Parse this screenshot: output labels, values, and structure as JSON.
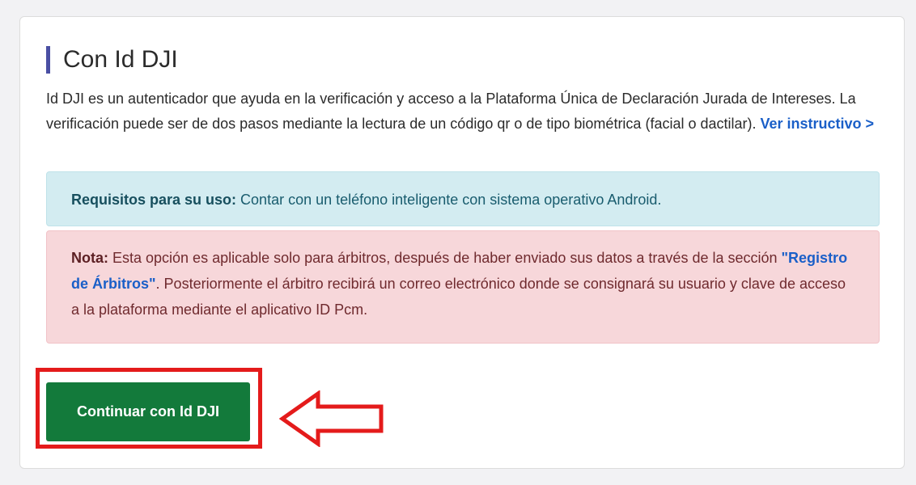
{
  "card": {
    "title": "Con Id DJI",
    "description": "Id DJI es un autenticador que ayuda en la verificación y acceso a la Plataforma Única de Declaración Jurada de Intereses. La verificación puede ser de dos pasos mediante la lectura de un código qr o de tipo biométrica (facial o dactilar).",
    "instructivo_link": "Ver instructivo >"
  },
  "requirements": {
    "label": "Requisitos para su uso:",
    "text": "Contar con un teléfono inteligente con sistema operativo Android."
  },
  "note": {
    "label": "Nota:",
    "text_before": "Esta opción es aplicable solo para árbitros, después de haber enviado sus datos a través de la sección",
    "link": "\"Registro de Árbitros\"",
    "text_after": ". Posteriormente el árbitro recibirá un correo electrónico donde se consignará su usuario y clave de acceso a la plataforma mediante el aplicativo ID Pcm."
  },
  "button": {
    "label": "Continuar con Id DJI"
  },
  "colors": {
    "title_accent": "#4a4fa3",
    "button": "#137a3b",
    "highlight": "#e41b1b",
    "link": "#1a5fc8"
  },
  "icons": {
    "annotation": "arrow-left-outline-icon"
  }
}
